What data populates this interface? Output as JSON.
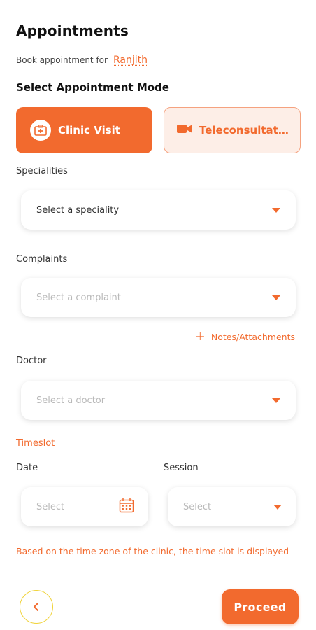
{
  "header": {
    "title": "Appointments",
    "book_for_label": "Book appointment for",
    "patient_name": "Ranjith"
  },
  "mode": {
    "heading": "Select Appointment Mode",
    "options": [
      {
        "label": "Clinic Visit",
        "icon": "clinic-icon",
        "selected": true
      },
      {
        "label": "Teleconsultati...",
        "icon": "video-camera-icon",
        "selected": false
      }
    ]
  },
  "specialities": {
    "label": "Specialities",
    "value": "Select a speciality"
  },
  "complaints": {
    "label": "Complaints",
    "placeholder": "Select a complaint"
  },
  "notes": {
    "label": "Notes/Attachments"
  },
  "doctor": {
    "label": "Doctor",
    "placeholder": "Select a doctor"
  },
  "timeslot": {
    "label": "Timeslot",
    "date_label": "Date",
    "date_placeholder": "Select",
    "session_label": "Session",
    "session_placeholder": "Select",
    "note": "Based on the time zone of the clinic, the time slot is displayed"
  },
  "footer": {
    "proceed_label": "Proceed"
  },
  "colors": {
    "accent": "#f26a2e",
    "accent_light": "#fdeee7",
    "back_border": "#f0d33a"
  }
}
